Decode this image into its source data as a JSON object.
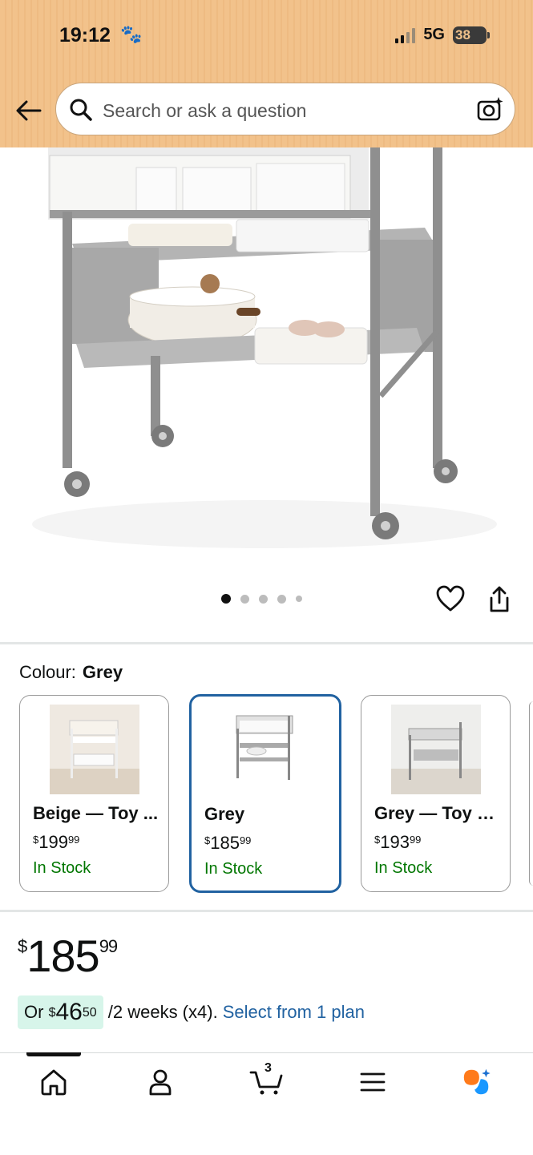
{
  "status_bar": {
    "time": "19:12",
    "network": "5G",
    "battery": "38"
  },
  "search": {
    "placeholder": "Search or ask a question"
  },
  "gallery": {
    "image_count": 5,
    "active_index": 0
  },
  "colour": {
    "label": "Colour:",
    "selected": "Grey",
    "options": [
      {
        "name": "Beige — Toy ...",
        "price_dollars": "199",
        "price_cents": "99",
        "stock": "In Stock"
      },
      {
        "name": "Grey",
        "price_dollars": "185",
        "price_cents": "99",
        "stock": "In Stock"
      },
      {
        "name": "Grey — Toy B...",
        "price_dollars": "193",
        "price_cents": "99",
        "stock": "In Stock"
      }
    ]
  },
  "price": {
    "currency": "$",
    "dollars": "185",
    "cents": "99"
  },
  "installment": {
    "prefix": "Or ",
    "currency": "$",
    "dollars": "46",
    "cents": "50",
    "suffix": " /2 weeks (x4).",
    "link": "Select from 1 plan"
  },
  "nav": {
    "cart_count": "3"
  },
  "colors": {
    "header_bg": "#f2c28b",
    "accent_blue": "#2162a1",
    "stock_green": "#007600",
    "highlight": "#d7f5ea"
  }
}
